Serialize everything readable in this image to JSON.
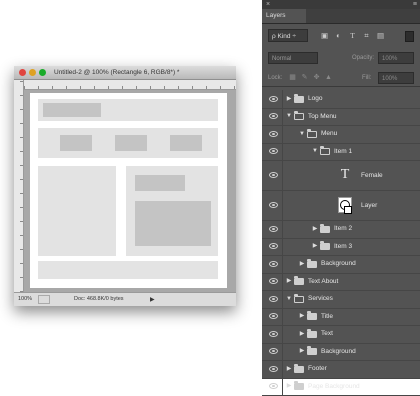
{
  "document": {
    "title": "Untitled-2 @ 100% (Rectangle 6, RGB/8*) *",
    "status_zoom": "100%",
    "status_doc": "Doc: 468.8K/0 bytes"
  },
  "layers_panel": {
    "close_glyph": "×",
    "menu_glyph": "≡",
    "tab_label": "Layers",
    "filter_kind": "ρ Kind ÷",
    "filter_icons": [
      "image-filter-icon",
      "adjustment-filter-icon",
      "type-filter-icon",
      "shape-filter-icon",
      "smart-object-filter-icon"
    ],
    "blend_mode": "Normal",
    "opacity_label": "Opacity:",
    "opacity_value": "100%",
    "lock_label": "Lock:",
    "lock_icons": [
      "lock-transparent-icon",
      "lock-image-icon",
      "lock-position-icon",
      "lock-all-icon"
    ],
    "fill_label": "Fill:",
    "fill_value": "100%",
    "layers": [
      {
        "name": "Logo",
        "kind": "group",
        "indent": 0,
        "open": false
      },
      {
        "name": "Top Menu",
        "kind": "group",
        "indent": 0,
        "open": true
      },
      {
        "name": "Menu",
        "kind": "group",
        "indent": 1,
        "open": true
      },
      {
        "name": "Item 1",
        "kind": "group",
        "indent": 2,
        "open": true
      },
      {
        "name": "Female",
        "kind": "type",
        "indent": 3
      },
      {
        "name": "Layer",
        "kind": "shape",
        "indent": 3
      },
      {
        "name": "Item 2",
        "kind": "group",
        "indent": 2,
        "open": false
      },
      {
        "name": "Item 3",
        "kind": "group",
        "indent": 2,
        "open": false
      },
      {
        "name": "Background",
        "kind": "group",
        "indent": 1,
        "open": false
      },
      {
        "name": "Text About",
        "kind": "group",
        "indent": 0,
        "open": false
      },
      {
        "name": "Services",
        "kind": "group",
        "indent": 0,
        "open": true
      },
      {
        "name": "Title",
        "kind": "group",
        "indent": 1,
        "open": false
      },
      {
        "name": "Text",
        "kind": "group",
        "indent": 1,
        "open": false
      },
      {
        "name": "Background",
        "kind": "group",
        "indent": 1,
        "open": false
      },
      {
        "name": "Footer",
        "kind": "group",
        "indent": 0,
        "open": false
      },
      {
        "name": "Page Background",
        "kind": "group",
        "indent": 0,
        "open": false
      }
    ]
  }
}
